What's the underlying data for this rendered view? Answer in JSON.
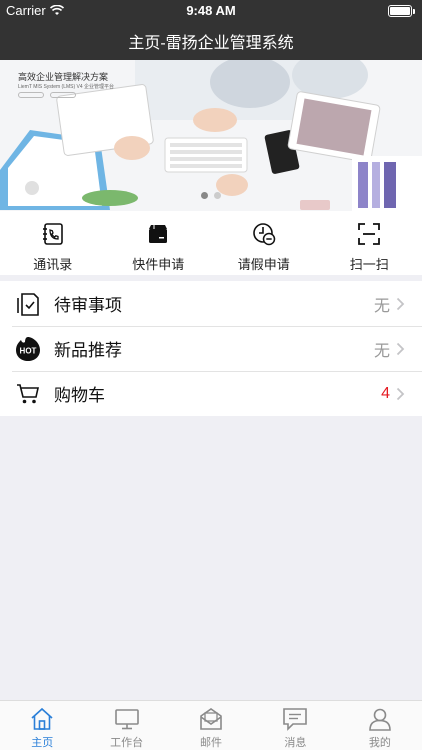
{
  "status_bar": {
    "carrier": "Carrier",
    "time": "9:48 AM"
  },
  "nav": {
    "title": "主页-雷扬企业管理系统"
  },
  "banner": {
    "headline": "高效企业管理解决方案",
    "subline": "LiemT MIS System (LMS) V4 企业管理平台",
    "page_index": 0,
    "page_count": 2
  },
  "quick_actions": [
    {
      "label": "通讯录",
      "icon": "contacts-book-icon"
    },
    {
      "label": "快件申请",
      "icon": "package-icon"
    },
    {
      "label": "请假申请",
      "icon": "clock-minus-icon"
    },
    {
      "label": "扫一扫",
      "icon": "scan-frame-icon"
    }
  ],
  "list": [
    {
      "label": "待审事项",
      "value": "无",
      "icon": "checklist-icon"
    },
    {
      "label": "新品推荐",
      "value": "无",
      "icon": "hot-badge-icon",
      "badge_text": "HOT"
    },
    {
      "label": "购物车",
      "value": "4",
      "icon": "cart-icon",
      "value_color": "#e51c23"
    }
  ],
  "tabs": [
    {
      "label": "主页",
      "icon": "home-icon",
      "active": true
    },
    {
      "label": "工作台",
      "icon": "monitor-icon",
      "active": false
    },
    {
      "label": "邮件",
      "icon": "mail-icon",
      "active": false
    },
    {
      "label": "消息",
      "icon": "message-icon",
      "active": false
    },
    {
      "label": "我的",
      "icon": "user-icon",
      "active": false
    }
  ],
  "colors": {
    "nav_bg": "#333333",
    "accent": "#2a7fd8",
    "badge_red": "#e51c23"
  }
}
